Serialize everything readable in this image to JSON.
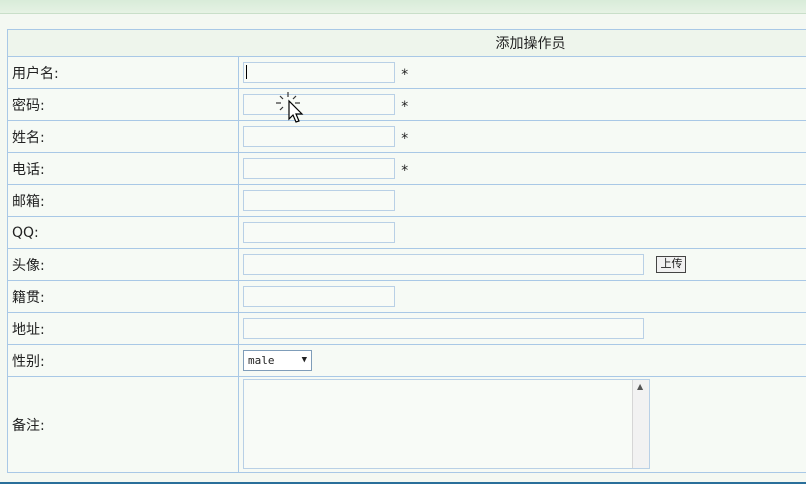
{
  "form": {
    "title": "添加操作员",
    "required_mark": "*",
    "fields": {
      "username": {
        "label": "用户名:",
        "value": ""
      },
      "password": {
        "label": "密码:",
        "value": ""
      },
      "name": {
        "label": "姓名:",
        "value": ""
      },
      "phone": {
        "label": "电话:",
        "value": ""
      },
      "email": {
        "label": "邮箱:",
        "value": ""
      },
      "qq": {
        "label": "QQ:",
        "value": ""
      },
      "avatar": {
        "label": "头像:",
        "value": "",
        "upload_label": "上传"
      },
      "hometown": {
        "label": "籍贯:",
        "value": ""
      },
      "address": {
        "label": "地址:",
        "value": ""
      },
      "gender": {
        "label": "性别:",
        "selected": "male"
      },
      "remarks": {
        "label": "备注:",
        "value": ""
      }
    }
  },
  "icons": {
    "select_arrow": "dropdown-arrow-icon",
    "scroll_up": "scroll-up-icon",
    "cursor": "busy-pointer-icon"
  }
}
